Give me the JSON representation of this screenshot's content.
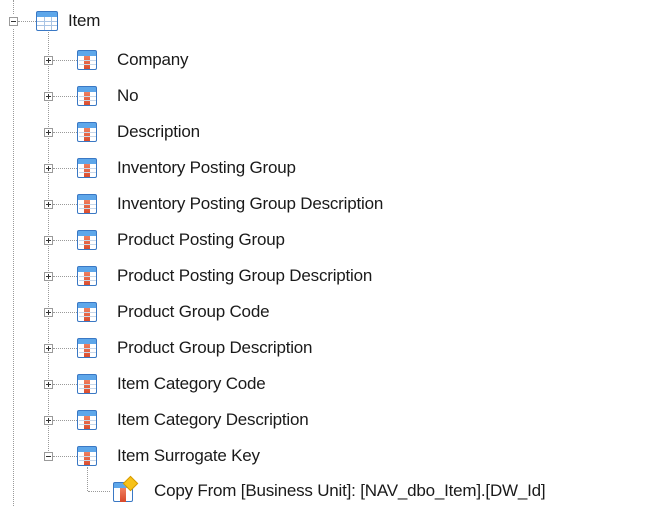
{
  "tree": {
    "root": {
      "label": "Item",
      "icon": "table-icon",
      "expanded": true
    },
    "children": [
      {
        "label": "Company",
        "icon": "column-icon",
        "expanded": false
      },
      {
        "label": "No",
        "icon": "column-icon",
        "expanded": false
      },
      {
        "label": "Description",
        "icon": "column-icon",
        "expanded": false
      },
      {
        "label": "Inventory Posting Group",
        "icon": "column-icon",
        "expanded": false
      },
      {
        "label": "Inventory Posting Group Description",
        "icon": "column-icon",
        "expanded": false
      },
      {
        "label": "Product Posting Group",
        "icon": "column-icon",
        "expanded": false
      },
      {
        "label": "Product Posting Group Description",
        "icon": "column-icon",
        "expanded": false
      },
      {
        "label": "Product Group Code",
        "icon": "column-icon",
        "expanded": false
      },
      {
        "label": "Product Group Description",
        "icon": "column-icon",
        "expanded": false
      },
      {
        "label": "Item Category Code",
        "icon": "column-icon",
        "expanded": false
      },
      {
        "label": "Item Category Description",
        "icon": "column-icon",
        "expanded": false
      },
      {
        "label": "Item Surrogate Key",
        "icon": "column-icon",
        "expanded": true
      }
    ],
    "leaf": {
      "label": "Copy From [Business Unit]: [NAV_dbo_Item].[DW_Id]",
      "icon": "mapping-icon"
    }
  },
  "colors": {
    "line": "#9a9a9a",
    "icon_blue": "#5ea7ea",
    "icon_border": "#3a78c4",
    "column_red": "#d8482a",
    "mapping_yellow": "#f7c219"
  }
}
